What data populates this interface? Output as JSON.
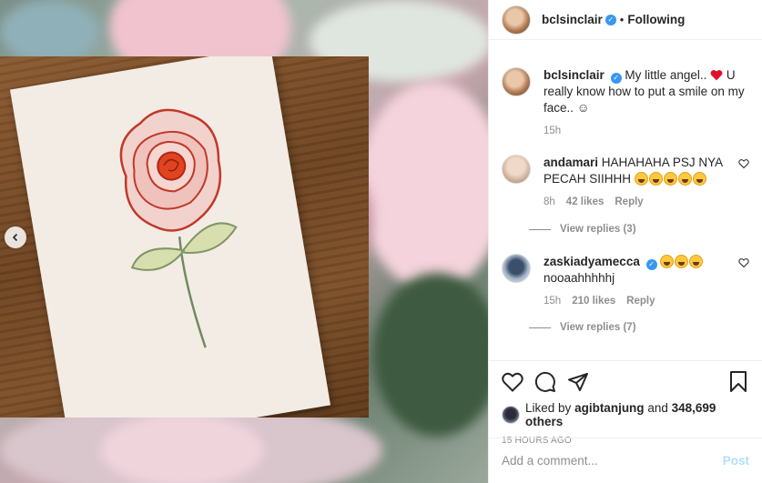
{
  "post": {
    "author": "bclsinclair",
    "following_label": "Following",
    "separator": "•"
  },
  "caption": {
    "username": "bclsinclair",
    "text_part1": "My little angel..",
    "text_part2": "U really know how to put a smile on my face.. ☺",
    "time": "15h"
  },
  "comments": [
    {
      "username": "andamari",
      "text": "HAHAHAHA PSJ NYA PECAH SIIHHH",
      "emoji_count": 5,
      "time": "8h",
      "likes": "42 likes",
      "reply_label": "Reply",
      "view_replies": "View replies (3)"
    },
    {
      "username": "zaskiadyamecca",
      "text": "nooaahhhhhj",
      "emoji_count": 3,
      "time": "15h",
      "likes": "210 likes",
      "reply_label": "Reply",
      "view_replies": "View replies (7)"
    }
  ],
  "actions": {
    "liked_by_prefix": "Liked by",
    "liked_by_user": "agibtanjung",
    "liked_by_and": "and",
    "likes_count": "348,699 others",
    "time_ago": "15 HOURS AGO"
  },
  "add_comment": {
    "placeholder": "Add a comment...",
    "post_label": "Post"
  },
  "icons": [
    "chevron-left-icon",
    "verified-icon",
    "heart-icon",
    "comment-icon",
    "share-icon",
    "bookmark-icon",
    "small-heart-icon"
  ],
  "colors": {
    "verified": "#3897f0",
    "heart_red": "#ed4956",
    "post_disabled": "#b2dffc",
    "muted": "#8e8e8e"
  }
}
